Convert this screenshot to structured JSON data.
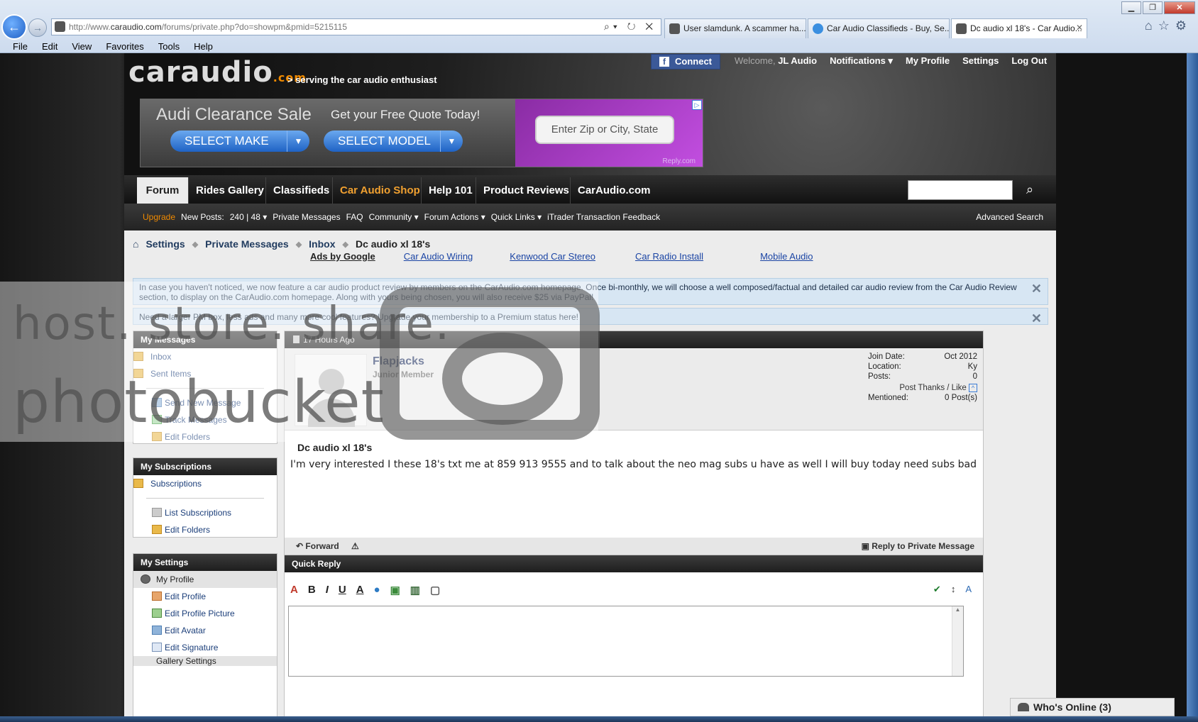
{
  "browser": {
    "address": "http://www.caraudio.com/forums/private.php?do=showpm&pmid=5215115",
    "address_prefix": "http://www.",
    "address_domain": "caraudio.com",
    "address_rest": "/forums/private.php?do=showpm&pmid=5215115",
    "tabs": [
      {
        "label": "User slamdunk. A scammer ha..."
      },
      {
        "label": "Car Audio Classifieds - Buy, Se..."
      },
      {
        "label": "Dc audio xl 18's - Car Audio..."
      }
    ],
    "menu": [
      "File",
      "Edit",
      "View",
      "Favorites",
      "Tools",
      "Help"
    ]
  },
  "header": {
    "logo": "caraudio",
    "logo_suffix": ".com",
    "tagline": "> serving the car audio enthusiast",
    "fb_connect": "Connect",
    "welcome": "Welcome,",
    "username": "JL Audio",
    "notifications": "Notifications ▾",
    "my_profile": "My Profile",
    "settings": "Settings",
    "logout": "Log Out"
  },
  "ad": {
    "headline": "Audi Clearance Sale",
    "sub": "Get your Free Quote Today!",
    "select_make": "SELECT MAKE",
    "select_model": "SELECT MODEL",
    "zip_placeholder": "Enter Zip or City, State",
    "brand": "Reply.com"
  },
  "nav": {
    "tabs": [
      "Forum",
      "Rides Gallery",
      "Classifieds",
      "Car Audio Shop",
      "Help 101",
      "Product Reviews",
      "CarAudio.com"
    ]
  },
  "subnav": {
    "upgrade": "Upgrade",
    "new_posts": "New Posts:",
    "counts": "240 | 48 ▾",
    "items": [
      "Private Messages",
      "FAQ",
      "Community ▾",
      "Forum Actions ▾",
      "Quick Links ▾",
      "iTrader Transaction Feedback"
    ],
    "advanced_search": "Advanced Search"
  },
  "breadcrumb": {
    "items": [
      "Settings",
      "Private Messages",
      "Inbox"
    ],
    "current": "Dc audio xl 18's"
  },
  "ads_google": {
    "label": "Ads by Google",
    "links": [
      "Car Audio Wiring",
      "Kenwood Car Stereo",
      "Car Radio Install",
      "Mobile Audio"
    ]
  },
  "notices": [
    "In case you haven't noticed, we now feature a car audio product review by members on the CarAudio.com homepage. Once bi-monthly, we will choose a well composed/factual and detailed car audio review from the Car Audio Review section, to display on the CarAudio.com homepage. Along with yours being chosen, you will also receive $25 via PayPal!",
    "Need a larger PM box, less ads and many more cool features? Upgrade your membership to a Premium status here!"
  ],
  "sidebar": {
    "messages": {
      "title": "My Messages",
      "folders": [
        "Inbox",
        "Sent Items"
      ],
      "actions": [
        "Send New Message",
        "Track Messages",
        "Edit Folders"
      ]
    },
    "subscriptions": {
      "title": "My Subscriptions",
      "folder": "Subscriptions",
      "actions": [
        "List Subscriptions",
        "Edit Folders"
      ]
    },
    "settings": {
      "title": "My Settings",
      "profile": "My Profile",
      "actions": [
        "Edit Profile",
        "Edit Profile Picture",
        "Edit Avatar",
        "Edit Signature"
      ],
      "gallery": "Gallery Settings"
    }
  },
  "pm": {
    "time": "17 Hours Ago",
    "sender": "Flapjacks",
    "rank": "Junior Member",
    "join_label": "Join Date:",
    "join_value": "Oct 2012",
    "location_label": "Location:",
    "location_value": "Ky",
    "posts_label": "Posts:",
    "posts_value": "0",
    "thanks": "Post Thanks / Like",
    "mentioned_label": "Mentioned:",
    "mentioned_value": "0 Post(s)",
    "title": "Dc audio xl 18's",
    "body": "I'm very interested I these 18's txt me at 859 913 9555 and to talk about the neo mag subs u have as well I will buy today need subs bad",
    "forward": "Forward",
    "reply": "Reply to Private Message"
  },
  "quick_reply": {
    "title": "Quick Reply"
  },
  "who_online": "Who's Online (3)",
  "watermark": {
    "line1": "host. store. share.",
    "line2": "photobucket"
  },
  "colors": {
    "accent_orange": "#f08a00",
    "link_blue": "#1c3f7a",
    "fb_blue": "#3b5998"
  }
}
